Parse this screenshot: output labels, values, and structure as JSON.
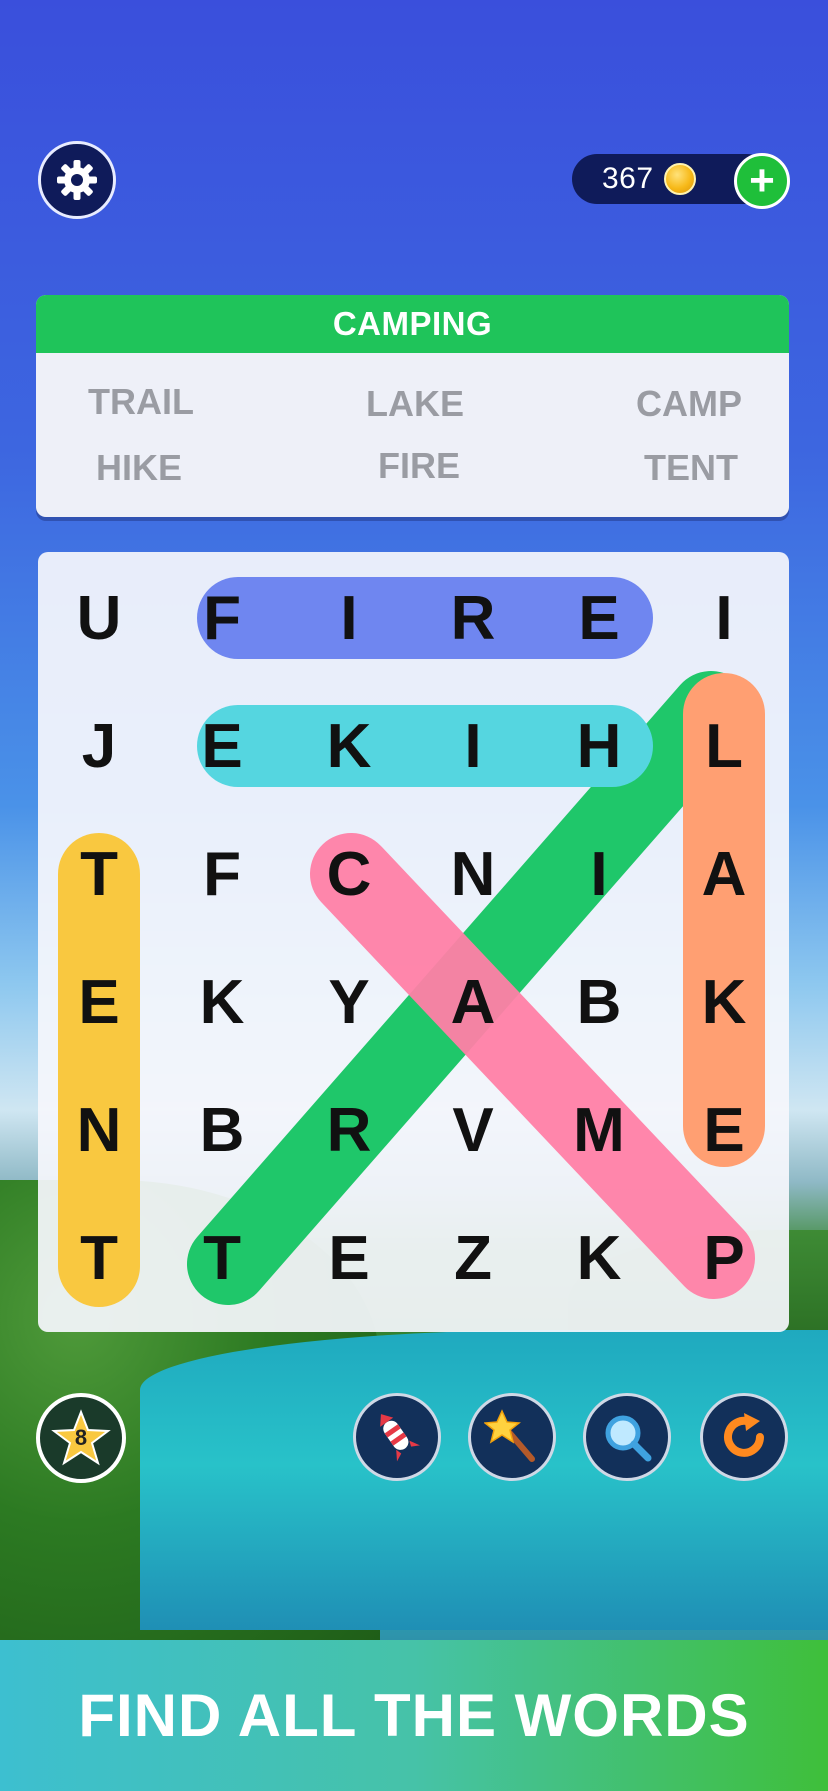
{
  "colors": {
    "fire_highlight": "#6f86f0",
    "hike_highlight": "#55d6e0",
    "tent_highlight": "#f9c840",
    "lake_highlight": "#ff9f72",
    "trail_highlight": "#1fc76a",
    "camp_highlight": "#ff7fa6",
    "header_green": "#1fc45a"
  },
  "coins": {
    "count": "367",
    "add_label": "+"
  },
  "category": {
    "title": "CAMPING",
    "words": [
      "TRAIL",
      "LAKE",
      "CAMP",
      "HIKE",
      "FIRE",
      "TENT"
    ]
  },
  "grid": {
    "rows": [
      [
        "U",
        "F",
        "I",
        "R",
        "E",
        "I"
      ],
      [
        "J",
        "E",
        "K",
        "I",
        "H",
        "L"
      ],
      [
        "T",
        "F",
        "C",
        "N",
        "I",
        "A"
      ],
      [
        "E",
        "K",
        "Y",
        "A",
        "B",
        "K"
      ],
      [
        "N",
        "B",
        "R",
        "V",
        "M",
        "E"
      ],
      [
        "T",
        "T",
        "E",
        "Z",
        "K",
        "P"
      ]
    ]
  },
  "level": {
    "number": "8"
  },
  "tools": [
    "rocket-icon",
    "magic-wand-icon",
    "magnifier-icon",
    "refresh-icon"
  ],
  "footer": {
    "text": "FIND ALL THE WORDS"
  }
}
